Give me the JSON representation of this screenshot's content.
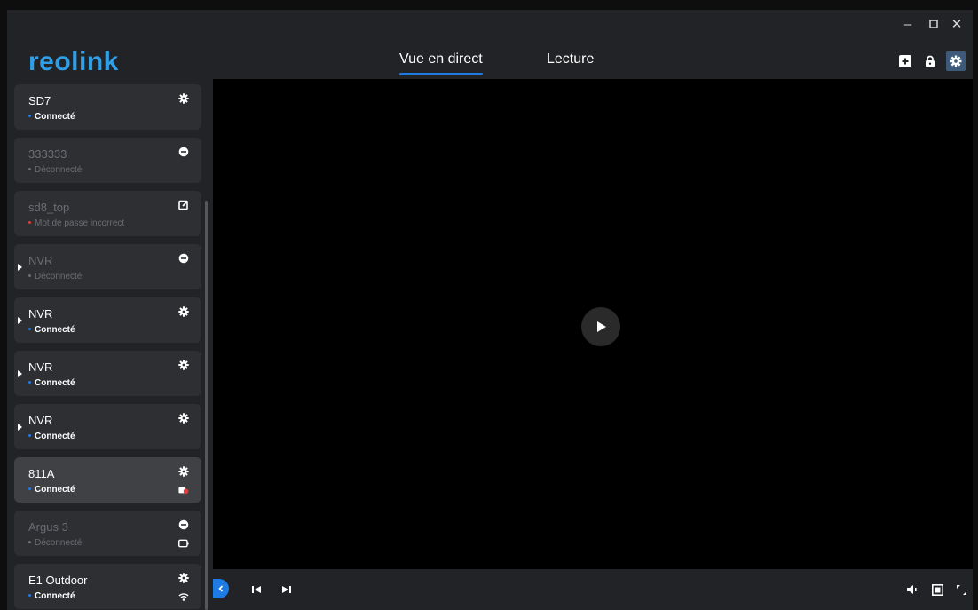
{
  "app": {
    "logo_text": "reolink",
    "brand_color": "#2f9fe8",
    "accent_color": "#1e7be6",
    "window_controls": {
      "minimize": "–",
      "maximize": "□",
      "close": "✕"
    }
  },
  "header": {
    "tabs": [
      {
        "label": "Vue en direct",
        "active": true
      },
      {
        "label": "Lecture",
        "active": false
      }
    ],
    "icons": [
      "add-device-icon",
      "lock-icon",
      "settings-icon"
    ]
  },
  "sidebar": {
    "devices": [
      {
        "name": "SD7",
        "status": "Connecté",
        "status_color": "#1e7be6",
        "action_icon": "gear-icon",
        "online": true
      },
      {
        "name": "333333",
        "status": "Déconnecté",
        "status_color": "#6c6d72",
        "action_icon": "minus-circle-icon",
        "online": false
      },
      {
        "name": "sd8_top",
        "status": "Mot de passe incorrect",
        "status_color": "#e23b3b",
        "action_icon": "edit-icon",
        "online": false
      },
      {
        "name": "NVR",
        "status": "Déconnecté",
        "status_color": "#6c6d72",
        "action_icon": "minus-circle-icon",
        "online": false,
        "expandable": true
      },
      {
        "name": "NVR",
        "status": "Connecté",
        "status_color": "#1e7be6",
        "action_icon": "gear-icon",
        "online": true,
        "expandable": true
      },
      {
        "name": "NVR",
        "status": "Connecté",
        "status_color": "#1e7be6",
        "action_icon": "gear-icon",
        "online": true,
        "expandable": true
      },
      {
        "name": "NVR",
        "status": "Connecté",
        "status_color": "#1e7be6",
        "action_icon": "gear-icon",
        "online": true,
        "expandable": true
      },
      {
        "name": "811A",
        "status": "Connecté",
        "status_color": "#1e7be6",
        "action_icon": "gear-icon",
        "online": true,
        "selected": true,
        "secondary_icon": "battery-alert-icon"
      },
      {
        "name": "Argus 3",
        "status": "Déconnecté",
        "status_color": "#6c6d72",
        "action_icon": "minus-circle-icon",
        "online": false,
        "secondary_icon": "battery-icon"
      },
      {
        "name": "E1 Outdoor",
        "status": "Connecté",
        "status_color": "#1e7be6",
        "action_icon": "gear-icon",
        "online": true,
        "secondary_icon": "wifi-icon"
      }
    ]
  },
  "player": {
    "play_icon": "play-icon",
    "controls_left": [
      "collapse-sidebar-icon",
      "skip-previous-icon",
      "skip-next-icon"
    ],
    "controls_right": [
      "volume-icon",
      "screen-layout-icon",
      "fullscreen-icon"
    ]
  }
}
